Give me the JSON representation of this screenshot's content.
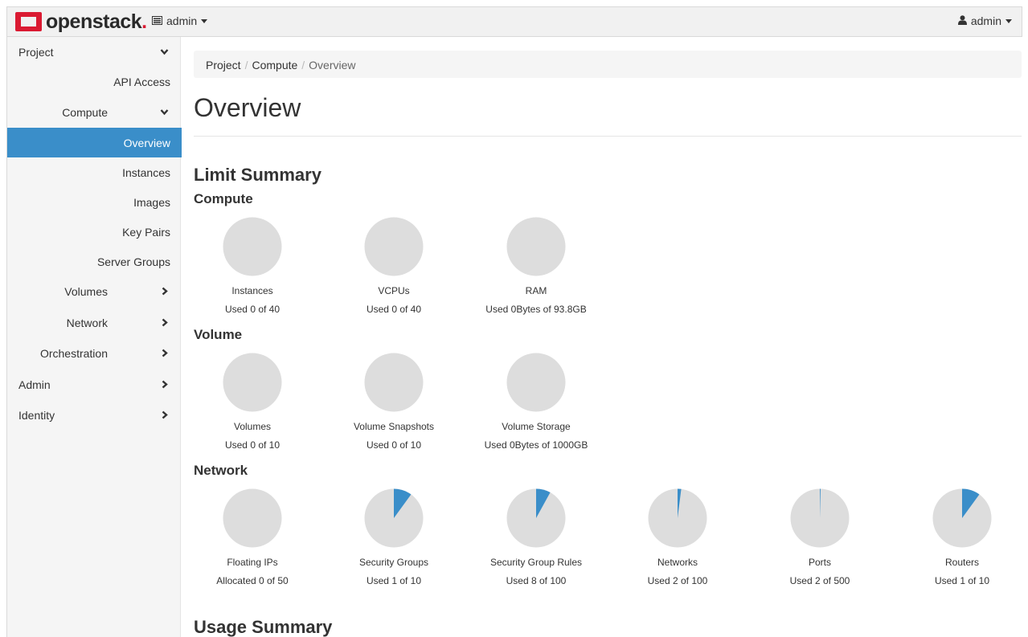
{
  "header": {
    "brand": "openstack",
    "project_selector": "admin",
    "user_menu": "admin"
  },
  "sidebar": {
    "items": [
      {
        "label": "Project",
        "level": 0,
        "chevron": "down",
        "active": false
      },
      {
        "label": "API Access",
        "level": 2,
        "chevron": "none",
        "active": false
      },
      {
        "label": "Compute",
        "level": 1,
        "chevron": "down",
        "active": false
      },
      {
        "label": "Overview",
        "level": 2,
        "chevron": "none",
        "active": true
      },
      {
        "label": "Instances",
        "level": 2,
        "chevron": "none",
        "active": false
      },
      {
        "label": "Images",
        "level": 2,
        "chevron": "none",
        "active": false
      },
      {
        "label": "Key Pairs",
        "level": 2,
        "chevron": "none",
        "active": false
      },
      {
        "label": "Server Groups",
        "level": 2,
        "chevron": "none",
        "active": false
      },
      {
        "label": "Volumes",
        "level": 1,
        "chevron": "right",
        "active": false
      },
      {
        "label": "Network",
        "level": 1,
        "chevron": "right",
        "active": false
      },
      {
        "label": "Orchestration",
        "level": 1,
        "chevron": "right",
        "active": false
      },
      {
        "label": "Admin",
        "level": 0,
        "chevron": "right",
        "active": false
      },
      {
        "label": "Identity",
        "level": 0,
        "chevron": "right",
        "active": false
      }
    ]
  },
  "breadcrumb": [
    "Project",
    "Compute",
    "Overview"
  ],
  "page_title": "Overview",
  "limit_summary": {
    "title": "Limit Summary",
    "sections": [
      {
        "title": "Compute",
        "pies": [
          {
            "name": "Instances",
            "usage": "Used 0 of 40",
            "used": 0,
            "total": 40
          },
          {
            "name": "VCPUs",
            "usage": "Used 0 of 40",
            "used": 0,
            "total": 40
          },
          {
            "name": "RAM",
            "usage": "Used 0Bytes of 93.8GB",
            "used": 0,
            "total": 93.8
          }
        ]
      },
      {
        "title": "Volume",
        "pies": [
          {
            "name": "Volumes",
            "usage": "Used 0 of 10",
            "used": 0,
            "total": 10
          },
          {
            "name": "Volume Snapshots",
            "usage": "Used 0 of 10",
            "used": 0,
            "total": 10
          },
          {
            "name": "Volume Storage",
            "usage": "Used 0Bytes of 1000GB",
            "used": 0,
            "total": 1000
          }
        ]
      },
      {
        "title": "Network",
        "pies": [
          {
            "name": "Floating IPs",
            "usage": "Allocated 0 of 50",
            "used": 0,
            "total": 50
          },
          {
            "name": "Security Groups",
            "usage": "Used 1 of 10",
            "used": 1,
            "total": 10
          },
          {
            "name": "Security Group Rules",
            "usage": "Used 8 of 100",
            "used": 8,
            "total": 100
          },
          {
            "name": "Networks",
            "usage": "Used 2 of 100",
            "used": 2,
            "total": 100
          },
          {
            "name": "Ports",
            "usage": "Used 2 of 500",
            "used": 2,
            "total": 500
          },
          {
            "name": "Routers",
            "usage": "Used 1 of 10",
            "used": 1,
            "total": 10
          }
        ]
      }
    ]
  },
  "usage_summary": {
    "title": "Usage Summary"
  },
  "colors": {
    "accent": "#3a8ec9",
    "pie_empty": "#dddddd",
    "brand_red": "#da1a32"
  },
  "icons": {
    "brand": "openstack-logo-icon",
    "project_selector": "server-list-icon",
    "user_menu": "user-icon",
    "expanded": "chevron-down-icon",
    "collapsed": "chevron-right-icon"
  }
}
